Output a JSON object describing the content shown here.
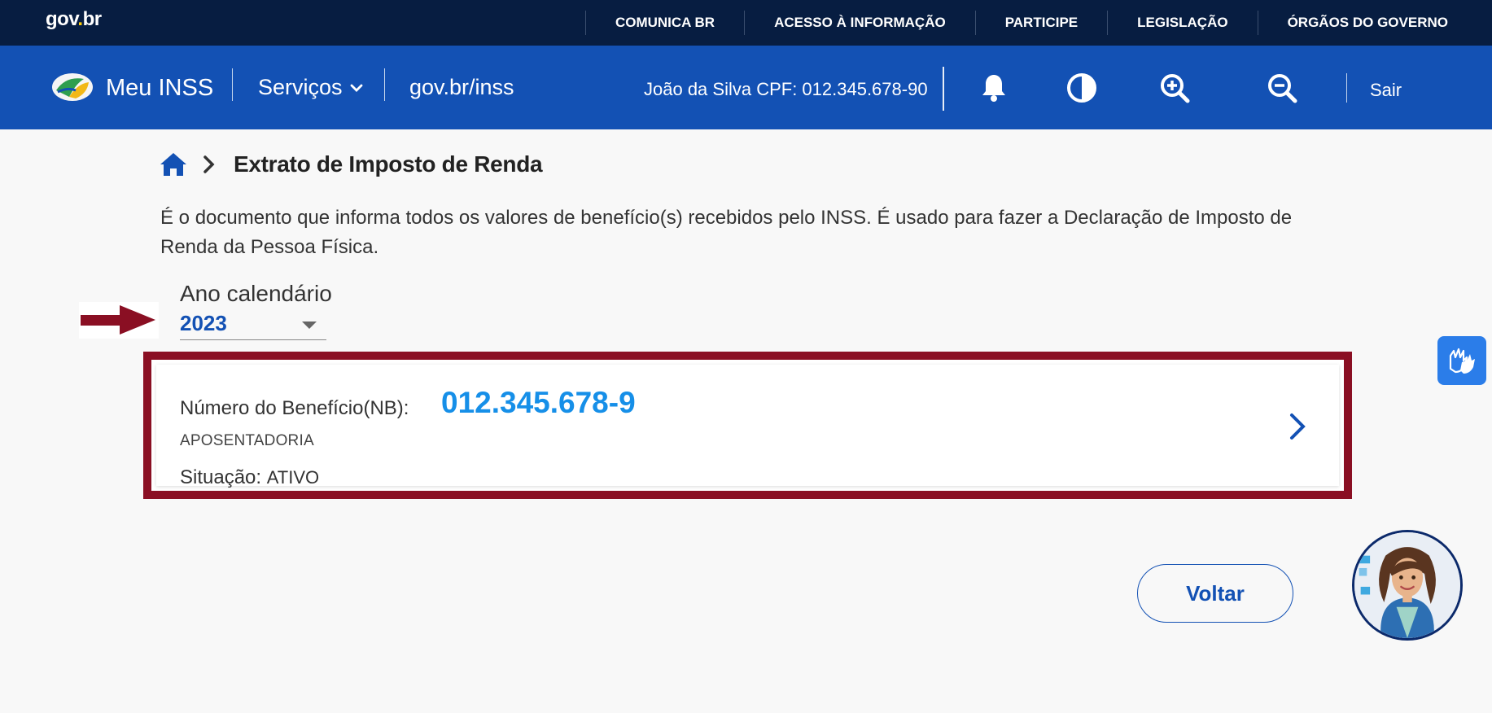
{
  "govbar": {
    "logo_text": "gov",
    "logo_dot": ".",
    "logo_suffix": "br",
    "links": [
      "COMUNICA BR",
      "ACESSO À INFORMAÇÃO",
      "PARTICIPE",
      "LEGISLAÇÃO",
      "ÓRGÃOS DO GOVERNO"
    ]
  },
  "header": {
    "app_name": "Meu INSS",
    "servicos_label": "Serviços",
    "govbr_inss_link": "gov.br/inss",
    "user_info": "João da Silva CPF: 012.345.678-90",
    "icons": [
      "bell-icon",
      "contrast-icon",
      "zoom-in-icon",
      "zoom-out-icon"
    ],
    "sair_label": "Sair"
  },
  "breadcrumb": {
    "home_icon": "home-icon",
    "title": "Extrato de Imposto de Renda"
  },
  "description": "É o documento que informa todos os valores de benefício(s) recebidos pelo INSS. É usado para fazer a Declaração de Imposto de Renda da Pessoa Física.",
  "year_select": {
    "label": "Ano calendário",
    "value": "2023"
  },
  "benefit_card": {
    "nb_label": "Número do Benefício(NB):",
    "nb_value": "012.345.678-9",
    "type": "APOSENTADORIA",
    "status_label": "Situação:",
    "status_value": "ATIVO"
  },
  "actions": {
    "voltar_label": "Voltar"
  },
  "colors": {
    "gov_bar": "#071d41",
    "header_blue": "#1351b4",
    "nb_blue": "#168fe8",
    "highlight_red": "#8a0f23"
  }
}
